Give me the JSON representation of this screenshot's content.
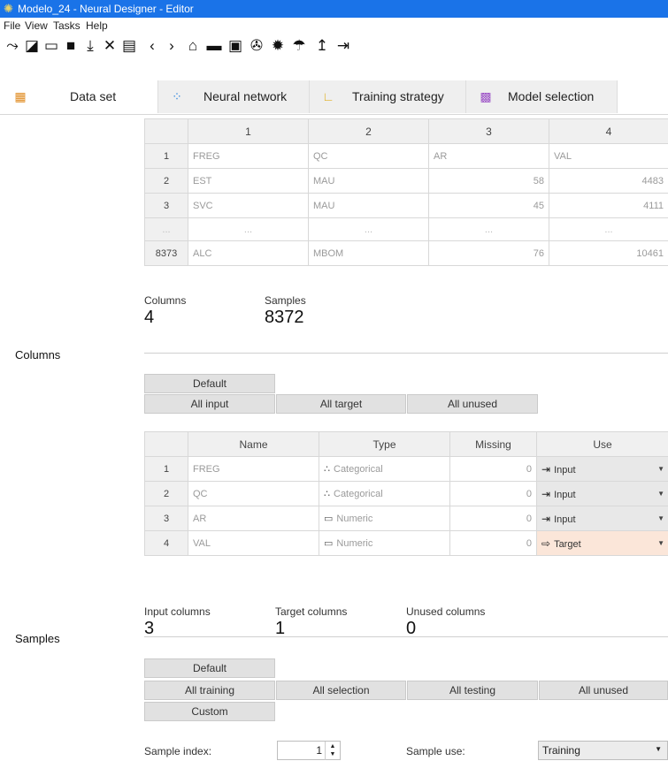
{
  "window": {
    "title": "Modelo_24 - Neural Designer - Editor"
  },
  "menu": [
    "File",
    "View",
    "Tasks",
    "Help"
  ],
  "toolbar_icons": [
    "line-chart-icon",
    "edit-icon",
    "open-folder-icon",
    "save-icon",
    "download-icon",
    "close-icon",
    "document-icon",
    "back-icon",
    "forward-icon",
    "home-icon",
    "comment-icon",
    "play-icon",
    "network-icon",
    "settings-icon",
    "signal-icon",
    "upload-icon",
    "export-icon"
  ],
  "tabs": [
    {
      "label": "Data set",
      "icon": "dataset-icon"
    },
    {
      "label": "Neural network",
      "icon": "neural-network-icon"
    },
    {
      "label": "Training strategy",
      "icon": "training-strategy-icon"
    },
    {
      "label": "Model selection",
      "icon": "model-selection-icon"
    }
  ],
  "preview": {
    "headers": [
      "1",
      "2",
      "3",
      "4"
    ],
    "rows": [
      {
        "idx": "1",
        "cells": [
          "FREG",
          "QC",
          "AR",
          "VAL"
        ]
      },
      {
        "idx": "2",
        "cells": [
          "EST",
          "MAU",
          "58",
          "4483"
        ]
      },
      {
        "idx": "3",
        "cells": [
          "SVC",
          "MAU",
          "45",
          "4111"
        ]
      },
      {
        "idx": "...",
        "cells": [
          "...",
          "...",
          "...",
          "..."
        ]
      },
      {
        "idx": "8373",
        "cells": [
          "ALC",
          "MBOM",
          "76",
          "10461"
        ]
      }
    ]
  },
  "summary": {
    "columns_label": "Columns",
    "columns_value": "4",
    "samples_label": "Samples",
    "samples_value": "8372"
  },
  "columns_section": {
    "title": "Columns",
    "buttons": {
      "default": "Default",
      "all_input": "All input",
      "all_target": "All target",
      "all_unused": "All unused"
    },
    "headers": [
      "Name",
      "Type",
      "Missing",
      "Use"
    ],
    "rows": [
      {
        "idx": "1",
        "name": "FREG",
        "type": "Categorical",
        "type_icon": "categorical-icon",
        "missing": "0",
        "use": "Input",
        "use_icon": "input-icon"
      },
      {
        "idx": "2",
        "name": "QC",
        "type": "Categorical",
        "type_icon": "categorical-icon",
        "missing": "0",
        "use": "Input",
        "use_icon": "input-icon"
      },
      {
        "idx": "3",
        "name": "AR",
        "type": "Numeric",
        "type_icon": "numeric-icon",
        "missing": "0",
        "use": "Input",
        "use_icon": "input-icon"
      },
      {
        "idx": "4",
        "name": "VAL",
        "type": "Numeric",
        "type_icon": "numeric-icon",
        "missing": "0",
        "use": "Target",
        "use_icon": "target-icon"
      }
    ],
    "stats": {
      "input_label": "Input columns",
      "input_value": "3",
      "target_label": "Target columns",
      "target_value": "1",
      "unused_label": "Unused columns",
      "unused_value": "0"
    }
  },
  "samples_section": {
    "title": "Samples",
    "buttons": {
      "default": "Default",
      "all_training": "All training",
      "all_selection": "All selection",
      "all_testing": "All testing",
      "all_unused": "All unused",
      "custom": "Custom"
    },
    "sample_index_label": "Sample index:",
    "sample_index_value": "1",
    "sample_use_label": "Sample use:",
    "sample_use_value": "Training"
  },
  "colors": {
    "titlebar": "#1a73e8",
    "target_highlight": "#fbe6d9",
    "use_cell": "#e8e8e8"
  }
}
